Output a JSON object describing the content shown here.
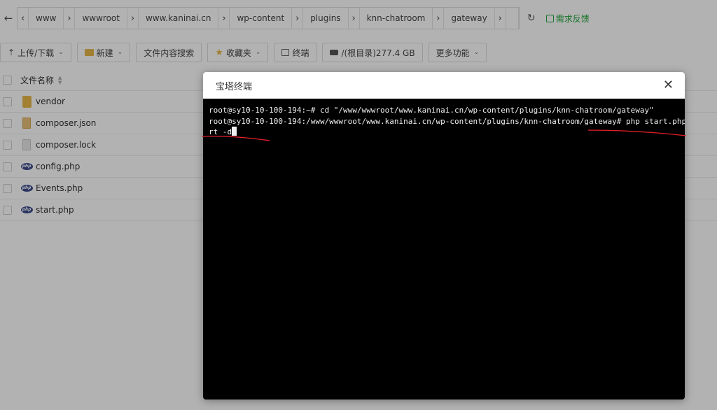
{
  "pathbar": {
    "back_glyph": "←",
    "segments": [
      "www",
      "wwwroot",
      "www.kaninai.cn",
      "wp-content",
      "plugins",
      "knn-chatroom",
      "gateway"
    ],
    "refresh_glyph": "↻",
    "feedback_label": "需求反馈"
  },
  "toolbar": {
    "upload_label": "上传/下载",
    "new_label": "新建",
    "search_label": "文件内容搜索",
    "favorites_label": "收藏夹",
    "terminal_label": "终端",
    "disk_label": "/(根目录)277.4 GB",
    "more_label": "更多功能"
  },
  "filelist": {
    "column_name": "文件名称",
    "rows": [
      {
        "name": "vendor",
        "icon": "folder-icon"
      },
      {
        "name": "composer.json",
        "icon": "json-file-icon"
      },
      {
        "name": "composer.lock",
        "icon": "file-icon"
      },
      {
        "name": "config.php",
        "icon": "php-file-icon"
      },
      {
        "name": "Events.php",
        "icon": "php-file-icon"
      },
      {
        "name": "start.php",
        "icon": "php-file-icon"
      }
    ]
  },
  "dialog": {
    "title": "宝塔终端",
    "close_glyph": "✕",
    "terminal_lines": [
      "root@sy10-10-100-194:~# cd \"/www/wwwroot/www.kaninai.cn/wp-content/plugins/knn-chatroom/gateway\"",
      "root@sy10-10-100-194:/www/wwwroot/www.kaninai.cn/wp-content/plugins/knn-chatroom/gateway# php start.php resta",
      "rt -d"
    ]
  },
  "colors": {
    "accent_green": "#20a53a",
    "annotation_red": "#e8202a",
    "terminal_bg": "#000000",
    "terminal_fg": "#f0f0f0"
  }
}
